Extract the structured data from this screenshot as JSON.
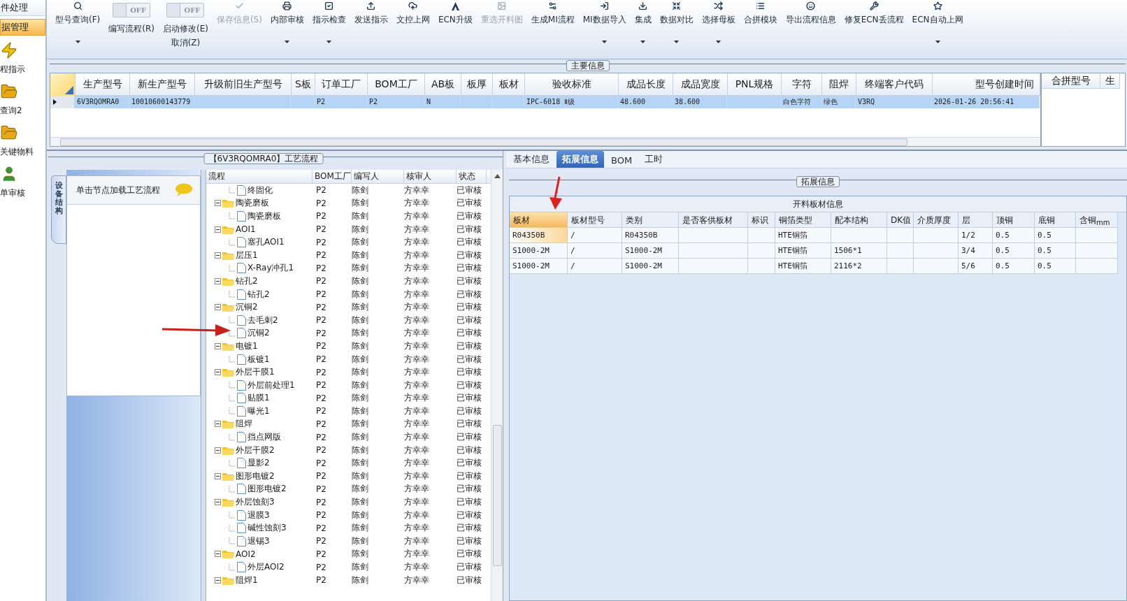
{
  "sidebar": {
    "items": [
      {
        "kind": "text",
        "label": "件处理",
        "selected": false
      },
      {
        "kind": "text",
        "label": "据管理",
        "selected": true
      },
      {
        "kind": "icon",
        "label": "程指示",
        "selected": false
      },
      {
        "kind": "icon",
        "label": "查询2",
        "selected": false
      },
      {
        "kind": "icon",
        "label": "关键物料",
        "selected": false
      },
      {
        "kind": "icon",
        "label": "单审核",
        "selected": false
      }
    ]
  },
  "toolbar": [
    {
      "kind": "button",
      "label": "型号查询(F)",
      "disabled": false,
      "dropdown": true
    },
    {
      "kind": "toggle",
      "label": "编写流程(R)",
      "state": "OFF"
    },
    {
      "kind": "toggle",
      "label": "启动修改(E)",
      "label2": "取消(Z)",
      "state": "OFF"
    },
    {
      "kind": "button",
      "label": "保存信息(S)",
      "disabled": true,
      "dropdown": false
    },
    {
      "kind": "button",
      "label": "内部审核",
      "disabled": false,
      "dropdown": true
    },
    {
      "kind": "button",
      "label": "指示检查",
      "disabled": false,
      "dropdown": true
    },
    {
      "kind": "button",
      "label": "发送指示",
      "disabled": false,
      "dropdown": false
    },
    {
      "kind": "button",
      "label": "文控上网",
      "disabled": false,
      "dropdown": false
    },
    {
      "kind": "button",
      "label": "ECN升级",
      "disabled": false,
      "dropdown": false
    },
    {
      "kind": "button",
      "label": "重选开料图",
      "disabled": true,
      "dropdown": false
    },
    {
      "kind": "button",
      "label": "生成MI流程",
      "disabled": false,
      "dropdown": false
    },
    {
      "kind": "button",
      "label": "MI数据导入",
      "disabled": false,
      "dropdown": true
    },
    {
      "kind": "button",
      "label": "集成",
      "disabled": false,
      "dropdown": true
    },
    {
      "kind": "button",
      "label": "数据对比",
      "disabled": false,
      "dropdown": true
    },
    {
      "kind": "button",
      "label": "选择母板",
      "disabled": false,
      "dropdown": true
    },
    {
      "kind": "button",
      "label": "合拼模块",
      "disabled": false,
      "dropdown": false
    },
    {
      "kind": "button",
      "label": "导出流程信息",
      "disabled": false,
      "dropdown": false
    },
    {
      "kind": "button",
      "label": "修复ECN丢流程",
      "disabled": false,
      "dropdown": false
    },
    {
      "kind": "button",
      "label": "ECN自动上网",
      "disabled": false,
      "dropdown": true
    }
  ],
  "main_info": {
    "title": "主要信息",
    "columns": [
      "生产型号",
      "新生产型号",
      "升级前旧生产型号",
      "S板",
      "订单工厂",
      "BOM工厂",
      "AB板",
      "板厚",
      "板材",
      "验收标准",
      "成品长度",
      "成品宽度",
      "PNL规格",
      "字符",
      "阻焊",
      "终端客户代码",
      "型号创建时间"
    ],
    "rows": [
      {
        "selected": true,
        "cells": [
          "6V3RQOMRA0",
          "10010600143779",
          "",
          "",
          "P2",
          "P2",
          "N",
          "",
          "",
          "IPC-6018 Ⅱ级",
          "48.600",
          "38.600",
          "",
          "白色字符",
          "绿色",
          "V3RQ",
          "2026-01-26 20:56:41"
        ]
      }
    ],
    "side_columns": [
      "合拼型号",
      "生"
    ]
  },
  "process": {
    "title": "【6V3RQOMRA0】工艺流程",
    "side_tab": "设备结构",
    "hint": "单击节点加载工艺流程",
    "columns": [
      "流程",
      "BOM工厂",
      "编写人",
      "核审人",
      "状态"
    ],
    "tree": [
      {
        "kind": "file",
        "label": "终固化",
        "bom": "P2",
        "writer": "陈剑",
        "reviewer": "方幸幸",
        "status": "已审核"
      },
      {
        "kind": "folder",
        "label": "陶瓷磨板",
        "bom": "P2",
        "writer": "陈剑",
        "reviewer": "方幸幸",
        "status": "已审核",
        "children": [
          {
            "kind": "file",
            "label": "陶瓷磨板",
            "bom": "P2",
            "writer": "陈剑",
            "reviewer": "方幸幸",
            "status": "已审核"
          }
        ]
      },
      {
        "kind": "folder",
        "label": "AOI1",
        "bom": "P2",
        "writer": "陈剑",
        "reviewer": "方幸幸",
        "status": "已审核",
        "children": [
          {
            "kind": "file",
            "label": "塞孔AOI1",
            "bom": "P2",
            "writer": "陈剑",
            "reviewer": "方幸幸",
            "status": "已审核"
          }
        ]
      },
      {
        "kind": "folder",
        "label": "层压1",
        "bom": "P2",
        "writer": "陈剑",
        "reviewer": "方幸幸",
        "status": "已审核",
        "children": [
          {
            "kind": "file",
            "label": "X-Ray冲孔1",
            "bom": "P2",
            "writer": "陈剑",
            "reviewer": "方幸幸",
            "status": "已审核"
          }
        ]
      },
      {
        "kind": "folder",
        "label": "钻孔2",
        "bom": "P2",
        "writer": "陈剑",
        "reviewer": "方幸幸",
        "status": "已审核",
        "children": [
          {
            "kind": "file",
            "label": "钻孔2",
            "bom": "P2",
            "writer": "陈剑",
            "reviewer": "方幸幸",
            "status": "已审核"
          }
        ]
      },
      {
        "kind": "folder",
        "label": "沉铜2",
        "bom": "P2",
        "writer": "陈剑",
        "reviewer": "方幸幸",
        "status": "已审核",
        "children": [
          {
            "kind": "file",
            "label": "去毛刺2",
            "bom": "P2",
            "writer": "陈剑",
            "reviewer": "方幸幸",
            "status": "已审核"
          },
          {
            "kind": "file",
            "label": "沉铜2",
            "bom": "P2",
            "writer": "陈剑",
            "reviewer": "方幸幸",
            "status": "已审核"
          }
        ]
      },
      {
        "kind": "folder",
        "label": "电镀1",
        "bom": "P2",
        "writer": "陈剑",
        "reviewer": "方幸幸",
        "status": "已审核",
        "children": [
          {
            "kind": "file",
            "label": "板镀1",
            "bom": "P2",
            "writer": "陈剑",
            "reviewer": "方幸幸",
            "status": "已审核"
          }
        ]
      },
      {
        "kind": "folder",
        "label": "外层干膜1",
        "bom": "P2",
        "writer": "陈剑",
        "reviewer": "方幸幸",
        "status": "已审核",
        "children": [
          {
            "kind": "file",
            "label": "外层前处理1",
            "bom": "P2",
            "writer": "陈剑",
            "reviewer": "方幸幸",
            "status": "已审核"
          },
          {
            "kind": "file",
            "label": "贴膜1",
            "bom": "P2",
            "writer": "陈剑",
            "reviewer": "方幸幸",
            "status": "已审核"
          },
          {
            "kind": "file",
            "label": "曝光1",
            "bom": "P2",
            "writer": "陈剑",
            "reviewer": "方幸幸",
            "status": "已审核"
          }
        ]
      },
      {
        "kind": "folder",
        "label": "阻焊",
        "bom": "P2",
        "writer": "陈剑",
        "reviewer": "方幸幸",
        "status": "已审核",
        "children": [
          {
            "kind": "file",
            "label": "挡点网版",
            "bom": "P2",
            "writer": "陈剑",
            "reviewer": "方幸幸",
            "status": "已审核"
          }
        ]
      },
      {
        "kind": "folder",
        "label": "外层干膜2",
        "bom": "P2",
        "writer": "陈剑",
        "reviewer": "方幸幸",
        "status": "已审核",
        "children": [
          {
            "kind": "file",
            "label": "显影2",
            "bom": "P2",
            "writer": "陈剑",
            "reviewer": "方幸幸",
            "status": "已审核"
          }
        ]
      },
      {
        "kind": "folder",
        "label": "图形电镀2",
        "bom": "P2",
        "writer": "陈剑",
        "reviewer": "方幸幸",
        "status": "已审核",
        "children": [
          {
            "kind": "file",
            "label": "图形电镀2",
            "bom": "P2",
            "writer": "陈剑",
            "reviewer": "方幸幸",
            "status": "已审核"
          }
        ]
      },
      {
        "kind": "folder",
        "label": "外层蚀刻3",
        "bom": "P2",
        "writer": "陈剑",
        "reviewer": "方幸幸",
        "status": "已审核",
        "children": [
          {
            "kind": "file",
            "label": "退膜3",
            "bom": "P2",
            "writer": "陈剑",
            "reviewer": "方幸幸",
            "status": "已审核"
          },
          {
            "kind": "file",
            "label": "碱性蚀刻3",
            "bom": "P2",
            "writer": "陈剑",
            "reviewer": "方幸幸",
            "status": "已审核"
          },
          {
            "kind": "file",
            "label": "退锡3",
            "bom": "P2",
            "writer": "陈剑",
            "reviewer": "方幸幸",
            "status": "已审核"
          }
        ]
      },
      {
        "kind": "folder",
        "label": "AOI2",
        "bom": "P2",
        "writer": "陈剑",
        "reviewer": "方幸幸",
        "status": "已审核",
        "children": [
          {
            "kind": "file",
            "label": "外层AOI2",
            "bom": "P2",
            "writer": "陈剑",
            "reviewer": "方幸幸",
            "status": "已审核"
          }
        ]
      },
      {
        "kind": "folder",
        "label": "阻焊1",
        "bom": "P2",
        "writer": "陈剑",
        "reviewer": "方幸幸",
        "status": "已审核"
      }
    ]
  },
  "detail": {
    "tabs": [
      {
        "label": "基本信息",
        "selected": false
      },
      {
        "label": "拓展信息",
        "selected": true
      },
      {
        "label": "BOM",
        "selected": false
      },
      {
        "label": "工时",
        "selected": false
      }
    ],
    "group_title": "拓展信息",
    "table_title": "开料板材信息",
    "columns": [
      {
        "label": "板材",
        "selected": true
      },
      {
        "label": "板材型号",
        "selected": false
      },
      {
        "label": "类别",
        "selected": false
      },
      {
        "label": "是否客供板材",
        "selected": false
      },
      {
        "label": "标识",
        "selected": false
      },
      {
        "label": "铜箔类型",
        "selected": false
      },
      {
        "label": "配本结构",
        "selected": false
      },
      {
        "label": "DK值",
        "selected": false
      },
      {
        "label": "介质厚度",
        "selected": false
      },
      {
        "label": "层",
        "selected": false
      },
      {
        "label": "顶铜",
        "selected": false
      },
      {
        "label": "底铜",
        "selected": false
      },
      {
        "label": "含铜$_{mm}$",
        "selected": false
      }
    ],
    "rows": [
      [
        "R04350B",
        "/",
        "R04350B",
        "",
        "",
        "HTE铜箔",
        "",
        "",
        "",
        "1/2",
        "0.5",
        "0.5",
        ""
      ],
      [
        "S1000-2M",
        "/",
        "S1000-2M",
        "",
        "",
        "HTE铜箔",
        "1506*1",
        "",
        "",
        "3/4",
        "0.5",
        "0.5",
        ""
      ],
      [
        "S1000-2M",
        "/",
        "S1000-2M",
        "",
        "",
        "HTE铜箔",
        "2116*2",
        "",
        "",
        "5/6",
        "0.5",
        "0.5",
        ""
      ]
    ]
  }
}
